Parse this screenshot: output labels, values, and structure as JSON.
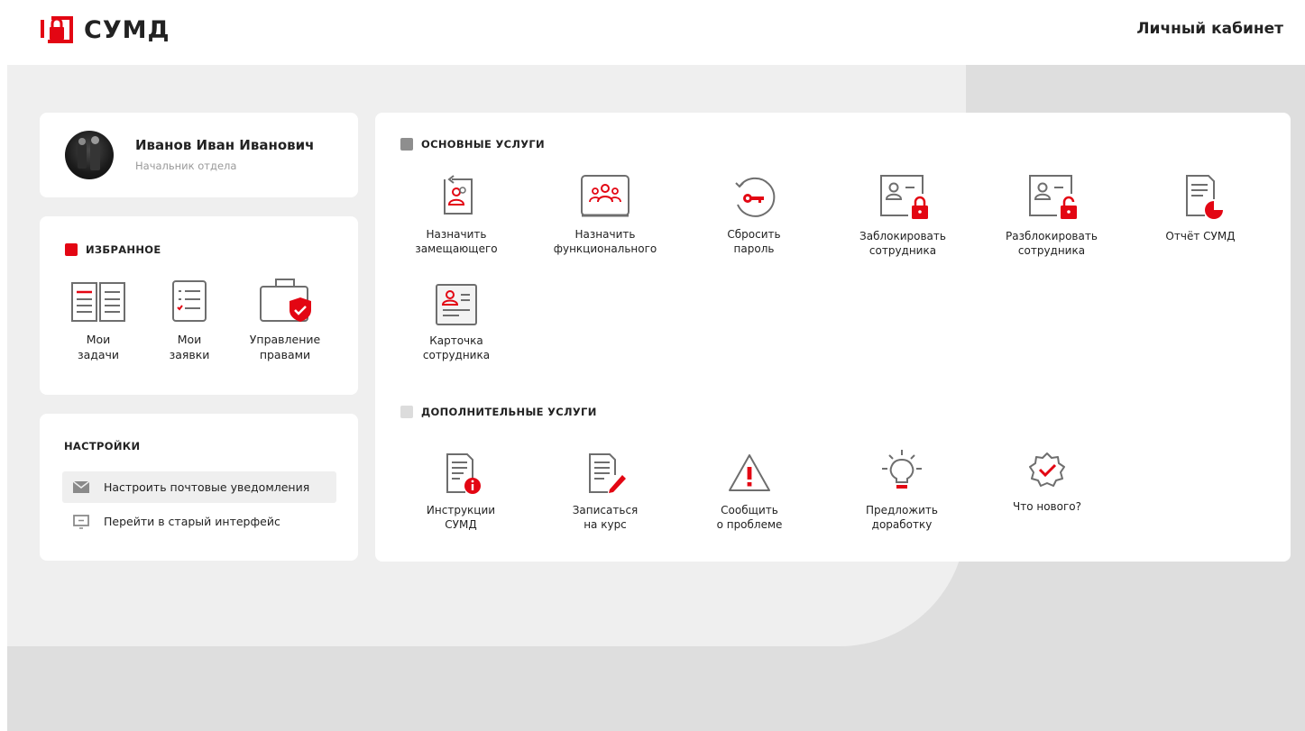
{
  "header": {
    "logo_text": "СУМД",
    "cabinet_label": "Личный кабинет"
  },
  "profile": {
    "name": "Иванов Иван Иванович",
    "role": "Начальник отдела"
  },
  "favorites": {
    "title": "ИЗБРАННОЕ",
    "items": [
      {
        "line1": "Мои",
        "line2": "задачи",
        "icon": "book-icon"
      },
      {
        "line1": "Мои",
        "line2": "заявки",
        "icon": "checklist-icon"
      },
      {
        "line1": "Управление",
        "line2": "правами",
        "icon": "briefcase-shield-icon"
      }
    ]
  },
  "settings": {
    "title": "НАСТРОЙКИ",
    "items": [
      {
        "label": "Настроить почтовые уведомления",
        "icon": "envelope-icon"
      },
      {
        "label": "Перейти в старый интерфейс",
        "icon": "monitor-icon"
      }
    ]
  },
  "main_services": {
    "title": "ОСНОВНЫЕ УСЛУГИ",
    "items": [
      {
        "line1": "Назначить",
        "line2": "замещающего",
        "icon": "assign-substitute-icon"
      },
      {
        "line1": "Назначить",
        "line2": "функционального",
        "icon": "assign-functional-icon"
      },
      {
        "line1": "Сбросить",
        "line2": "пароль",
        "icon": "key-reset-icon"
      },
      {
        "line1": "Заблокировать",
        "line2": "сотрудника",
        "icon": "lock-user-icon"
      },
      {
        "line1": "Разблокировать",
        "line2": "сотрудника",
        "icon": "unlock-user-icon"
      },
      {
        "line1": "Отчёт СУМД",
        "line2": "",
        "icon": "report-icon"
      },
      {
        "line1": "Карточка",
        "line2": "сотрудника",
        "icon": "employee-card-icon"
      }
    ]
  },
  "extra_services": {
    "title": "ДОПОЛНИТЕЛЬНЫЕ УСЛУГИ",
    "items": [
      {
        "line1": "Инструкции",
        "line2": "СУМД",
        "icon": "instructions-icon"
      },
      {
        "line1": "Записаться",
        "line2": "на курс",
        "icon": "course-signup-icon"
      },
      {
        "line1": "Сообщить",
        "line2": "о проблеме",
        "icon": "warning-icon"
      },
      {
        "line1": "Предложить",
        "line2": "доработку",
        "icon": "lightbulb-icon"
      },
      {
        "line1": "Что нового?",
        "line2": "",
        "icon": "badge-check-icon"
      }
    ]
  },
  "colors": {
    "accent": "#e30613",
    "icon_gray": "#6e6e6e",
    "bg_light": "#efefef",
    "bg_dark": "#dedede"
  }
}
